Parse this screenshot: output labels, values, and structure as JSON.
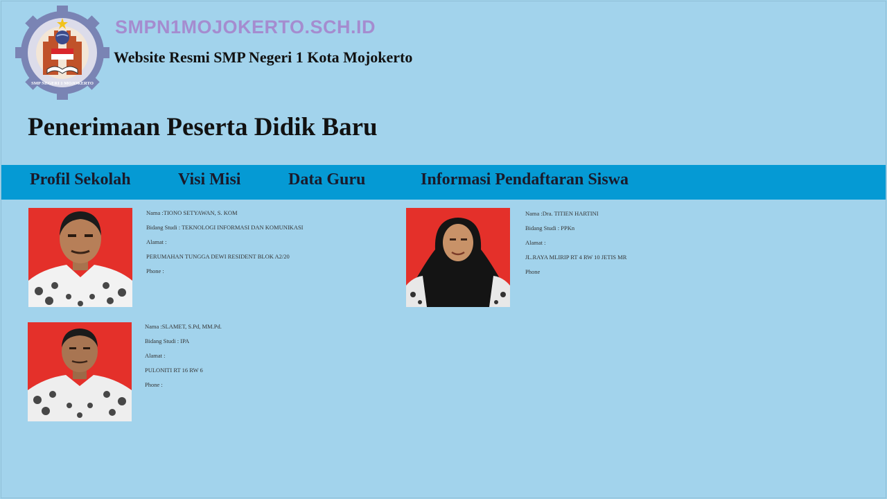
{
  "header": {
    "site_domain": "SMPN1MOJOKERTO.SCH.ID",
    "tagline": "Website Resmi SMP Negeri 1 Kota Mojokerto",
    "logo_text": "SMP NEGERI 1 MOJOKERTO",
    "logo_digit": "1"
  },
  "page_title": "Penerimaan Peserta Didik Baru",
  "nav": {
    "items": [
      {
        "label": "Profil Sekolah"
      },
      {
        "label": "Visi Misi"
      },
      {
        "label": "Data Guru"
      },
      {
        "label": "Informasi Pendaftaran Siswa"
      }
    ]
  },
  "teachers": [
    {
      "nama": "Nama :TIONO SETYAWAN, S. KOM",
      "bidang": "Bidang Studi : TEKNOLOGI INFORMASI DAN KOMUNIKASI",
      "alamat_label": "Alamat :",
      "alamat": "PERUMAHAN TUNGGA DEWI RESIDENT BLOK A2/20",
      "phone": "Phone :"
    },
    {
      "nama": "Nama :Dra. TITIEN HARTINI",
      "bidang": "Bidang Studi : PPKn",
      "alamat_label": "Alamat :",
      "alamat": "JL.RAYA MLIRIP RT 4 RW 10 JETIS MR",
      "phone": "Phone"
    },
    {
      "nama": "Nama :SLAMET, S.Pd, MM.Pd.",
      "bidang": "Bidang Studi : IPA",
      "alamat_label": "Alamat :",
      "alamat": "PULONITI RT 16 RW 6",
      "phone": "Phone :"
    }
  ],
  "colors": {
    "background": "#a2d3ec",
    "navbar": "#059ad4",
    "domain_text": "#a58ccf",
    "photo_background": "#e4302a"
  }
}
